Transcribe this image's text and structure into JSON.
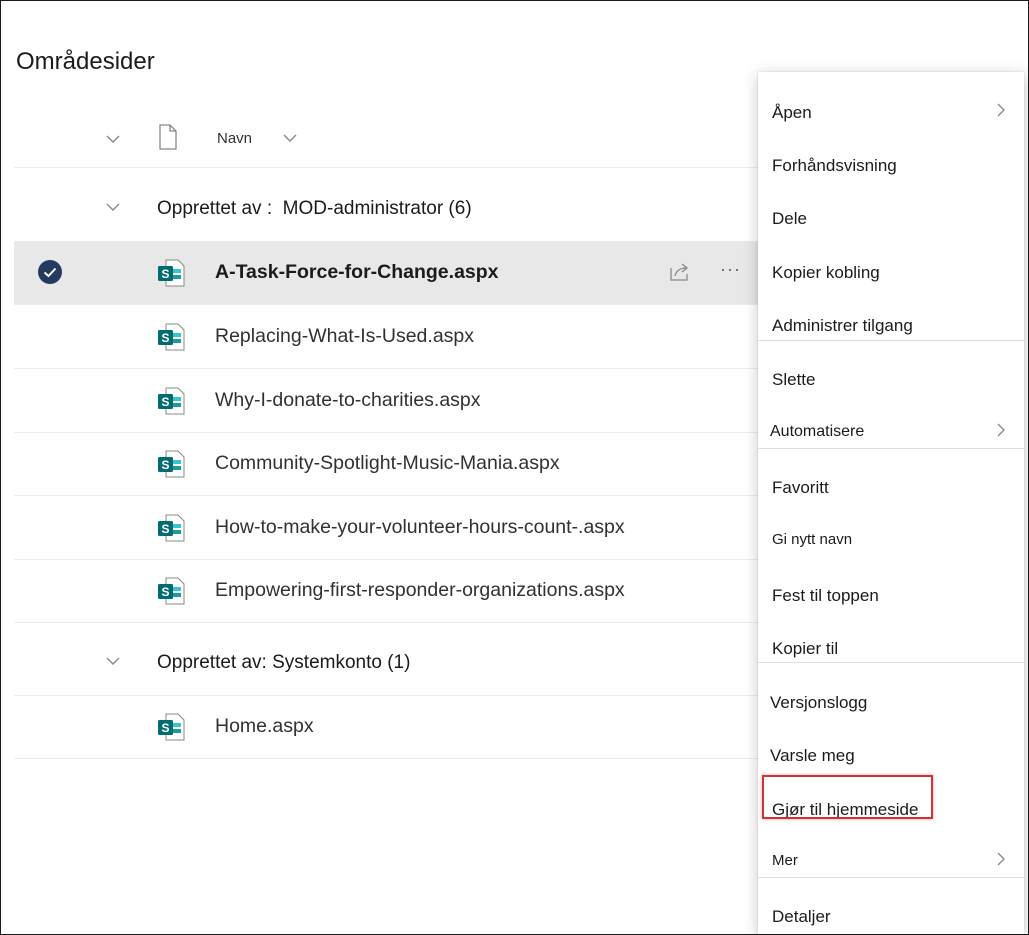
{
  "page": {
    "title": "Områdesider"
  },
  "header": {
    "column_name": "Navn"
  },
  "groups": [
    {
      "title": "Opprettet av :  MOD-administrator (6)"
    },
    {
      "title": "Opprettet av: Systemkonto (1)"
    }
  ],
  "files": [
    {
      "name": "A-Task-Force-for-Change.aspx"
    },
    {
      "name": "Replacing-What-Is-Used.aspx"
    },
    {
      "name": "Why-I-donate-to-charities.aspx"
    },
    {
      "name": "Community-Spotlight-Music-Mania.aspx"
    },
    {
      "name": "How-to-make-your-volunteer-hours-count-.aspx"
    },
    {
      "name": "Empowering-first-responder-organizations.aspx"
    },
    {
      "name": "Home.aspx"
    }
  ],
  "row_actions": {
    "more": "···"
  },
  "context_menu": {
    "items": [
      {
        "label": "Åpen"
      },
      {
        "label": "Forhåndsvisning"
      },
      {
        "label": "Dele"
      },
      {
        "label": "Kopier kobling"
      },
      {
        "label": "Administrer tilgang"
      },
      {
        "label": "Slette"
      },
      {
        "label": "Automatisere"
      },
      {
        "label": "Favoritt"
      },
      {
        "label": "Gi nytt navn"
      },
      {
        "label": "Fest til toppen"
      },
      {
        "label": "Kopier til"
      },
      {
        "label": "Versjonslogg"
      },
      {
        "label": "Varsle meg"
      },
      {
        "label": "Gjør til hjemmeside"
      },
      {
        "label": "Mer"
      },
      {
        "label": "Detaljer"
      }
    ]
  },
  "colors": {
    "highlight_border": "#d13438",
    "selected_row": "#e8e8e8",
    "sharepoint_green": "#036c70"
  }
}
